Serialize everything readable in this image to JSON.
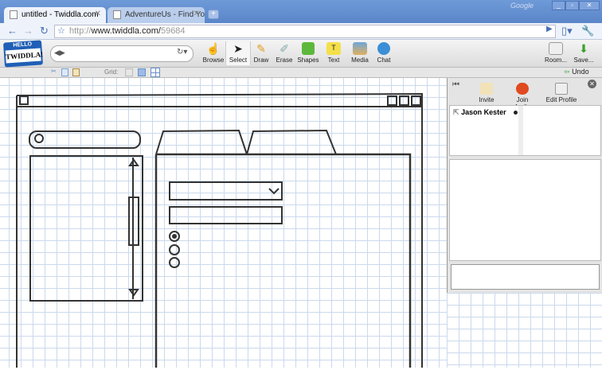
{
  "browser": {
    "tabs": [
      {
        "label": "untitled - Twiddla.com",
        "active": true
      },
      {
        "label": "AdventureUs - Find Your N...",
        "active": false
      }
    ],
    "new_tab": "+",
    "brand": "Google",
    "url_prefix": "http://",
    "url_host": "www.twiddla.com/",
    "url_path": "59684"
  },
  "app": {
    "logo_top": "HELLO",
    "logo_name": "TWIDDLA!",
    "tools": [
      {
        "label": "Browse",
        "icon": "hand-icon"
      },
      {
        "label": "Select",
        "icon": "arrow-icon"
      },
      {
        "label": "Draw",
        "icon": "pencil-icon"
      },
      {
        "label": "Erase",
        "icon": "eraser-icon"
      },
      {
        "label": "Shapes",
        "icon": "shapes-icon"
      },
      {
        "label": "Text",
        "icon": "text-icon"
      },
      {
        "label": "Media",
        "icon": "media-icon"
      },
      {
        "label": "Chat",
        "icon": "chat-icon"
      }
    ],
    "room_label": "Room...",
    "save_label": "Save...",
    "grid_label": "Grid:",
    "undo_label": "Undo"
  },
  "panel": {
    "invite": "Invite",
    "join_audio": "Join Audio",
    "edit_profile": "Edit Profile",
    "users": [
      "Jason Kester"
    ]
  },
  "colors": {
    "titlebar": "#6f9ad8",
    "grid": "#cbd9ec",
    "audio": "#e04a1f"
  }
}
